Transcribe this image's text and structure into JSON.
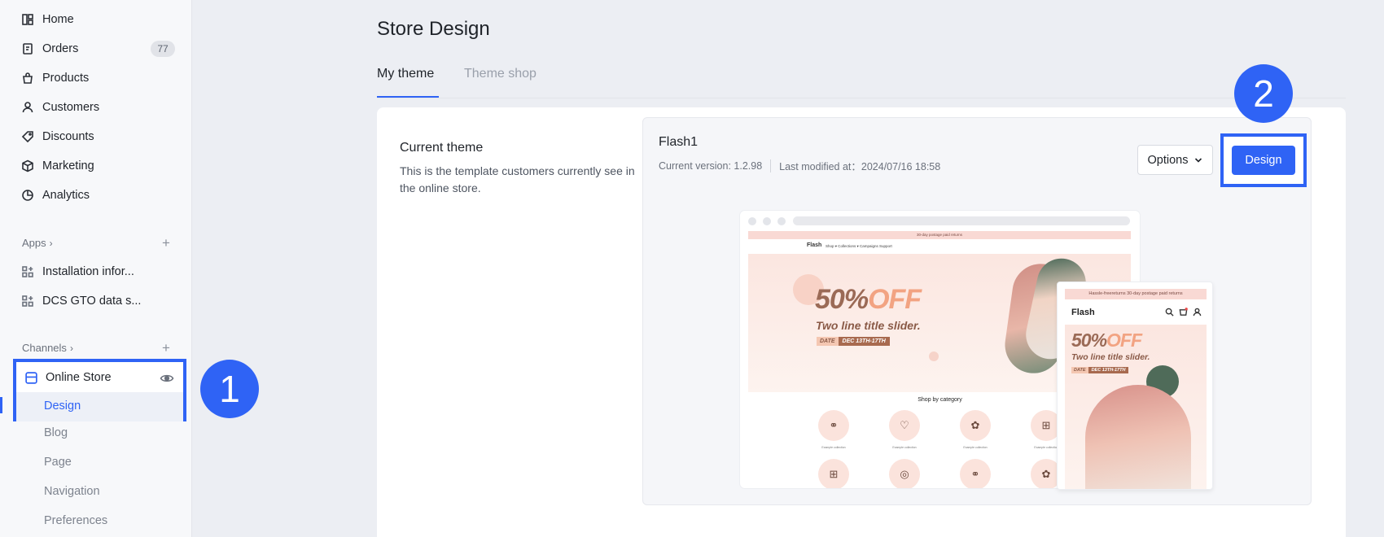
{
  "sidebar": {
    "nav": [
      {
        "label": "Home",
        "icon": "home-icon"
      },
      {
        "label": "Orders",
        "icon": "orders-icon",
        "badge": "77"
      },
      {
        "label": "Products",
        "icon": "bag-icon"
      },
      {
        "label": "Customers",
        "icon": "user-icon"
      },
      {
        "label": "Discounts",
        "icon": "tag-icon"
      },
      {
        "label": "Marketing",
        "icon": "cube-icon"
      },
      {
        "label": "Analytics",
        "icon": "pie-chart-icon"
      }
    ],
    "apps": {
      "title": "Apps",
      "items": [
        {
          "label": "Installation infor...",
          "icon": "app-grid-icon"
        },
        {
          "label": "DCS GTO data s...",
          "icon": "app-grid-icon"
        }
      ]
    },
    "channels": {
      "title": "Channels",
      "online_store": "Online Store",
      "sub_items": [
        "Design",
        "Blog",
        "Page",
        "Navigation",
        "Preferences"
      ]
    }
  },
  "callouts": {
    "first": "1",
    "second": "2"
  },
  "main": {
    "title": "Store Design",
    "tabs": [
      "My theme",
      "Theme shop"
    ],
    "current_theme": {
      "heading": "Current theme",
      "description": "This is the template customers currently see in the online store."
    },
    "theme": {
      "name": "Flash1",
      "version": "Current version: 1.2.98",
      "last_modified": "Last modified at：2024/07/16 18:58",
      "options_label": "Options",
      "design_label": "Design"
    },
    "preview": {
      "promo": "30-day postage paid returns",
      "logo": "Flash",
      "menu": "Shop ▾     Collections ▾     Campaigns     Support",
      "hero_big": "50%",
      "hero_off": "OFF",
      "hero_sub": "Two line title slider.",
      "date_label": "DATE",
      "date_value": "DEC 13TH-17TH",
      "shop_by_category": "Shop by category",
      "category_label": "Example collection",
      "mobile_promo": "Hassle-freereturns 30-day postage paid returns",
      "mobile_logo": "Flash"
    }
  },
  "colors": {
    "accent": "#2f63f5"
  }
}
